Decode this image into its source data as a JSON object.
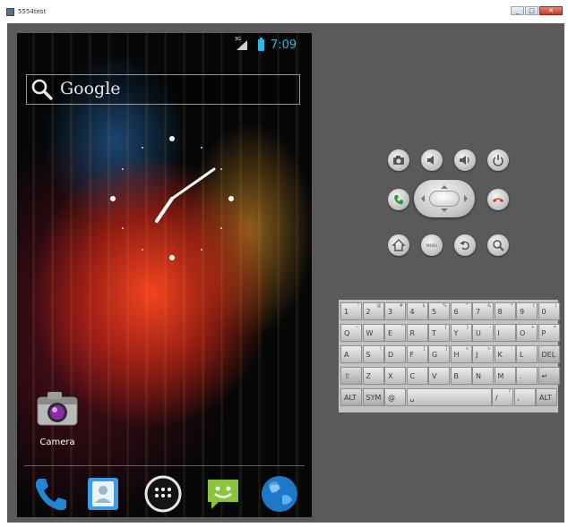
{
  "window": {
    "title": "5554test",
    "controls": [
      "_",
      "□",
      "✕"
    ]
  },
  "statusbar": {
    "network": "3G",
    "time": "7:09"
  },
  "search": {
    "brand": "Google"
  },
  "home": {
    "app_shortcuts": [
      {
        "label": "Camera",
        "icon": "camera-icon"
      }
    ],
    "dock": [
      {
        "icon": "phone-icon"
      },
      {
        "icon": "contacts-icon"
      },
      {
        "icon": "app-drawer-icon"
      },
      {
        "icon": "messaging-icon"
      },
      {
        "icon": "browser-globe-icon"
      }
    ]
  },
  "hardware_buttons": {
    "top_row": [
      "camera-icon",
      "volume-down-icon",
      "volume-up-icon",
      "power-icon"
    ],
    "middle_row": [
      "call-icon",
      "dpad",
      "end-call-icon"
    ],
    "bottom_row": [
      "home-icon",
      "menu-icon",
      "back-icon",
      "search-icon"
    ],
    "menu_label": "MENU"
  },
  "keyboard": {
    "rows": [
      [
        {
          "k": "1",
          "s": "!"
        },
        {
          "k": "2",
          "s": "@"
        },
        {
          "k": "3",
          "s": "#"
        },
        {
          "k": "4",
          "s": "$"
        },
        {
          "k": "5",
          "s": "%"
        },
        {
          "k": "6",
          "s": "^"
        },
        {
          "k": "7",
          "s": "&"
        },
        {
          "k": "8",
          "s": "*"
        },
        {
          "k": "9",
          "s": "("
        },
        {
          "k": "0",
          "s": ")"
        }
      ],
      [
        {
          "k": "Q",
          "s": "~"
        },
        {
          "k": "W",
          "s": ""
        },
        {
          "k": "E",
          "s": "\""
        },
        {
          "k": "R",
          "s": ""
        },
        {
          "k": "T",
          "s": "{"
        },
        {
          "k": "Y",
          "s": "}"
        },
        {
          "k": "U",
          "s": "-"
        },
        {
          "k": "I",
          "s": ""
        },
        {
          "k": "O",
          "s": "+"
        },
        {
          "k": "P",
          "s": "="
        }
      ],
      [
        {
          "k": "A",
          "s": ""
        },
        {
          "k": "S",
          "s": "\\"
        },
        {
          "k": "D",
          "s": ""
        },
        {
          "k": "F",
          "s": "["
        },
        {
          "k": "G",
          "s": "]"
        },
        {
          "k": "H",
          "s": "<"
        },
        {
          "k": "J",
          "s": ">"
        },
        {
          "k": "K",
          "s": ";"
        },
        {
          "k": "L",
          "s": ":"
        },
        {
          "k": "DEL",
          "s": ""
        }
      ],
      [
        {
          "k": "⇧",
          "s": ""
        },
        {
          "k": "Z",
          "s": ""
        },
        {
          "k": "X",
          "s": ""
        },
        {
          "k": "C",
          "s": ""
        },
        {
          "k": "V",
          "s": ""
        },
        {
          "k": "B",
          "s": ""
        },
        {
          "k": "N",
          "s": ""
        },
        {
          "k": "M",
          "s": ""
        },
        {
          "k": ".",
          "s": ""
        },
        {
          "k": "↵",
          "s": ""
        }
      ],
      [
        {
          "k": "ALT",
          "s": ""
        },
        {
          "k": "SYM",
          "s": ""
        },
        {
          "k": "@",
          "s": ""
        },
        {
          "k": "␣",
          "s": ""
        },
        {
          "k": "/",
          "s": "?"
        },
        {
          "k": ",",
          "s": ""
        },
        {
          "k": "ALT",
          "s": ""
        }
      ]
    ]
  },
  "colors": {
    "status_accent": "#33b5e5",
    "emulator_body": "#5a5a5a",
    "keyboard_bg": "#c2c2c2"
  }
}
